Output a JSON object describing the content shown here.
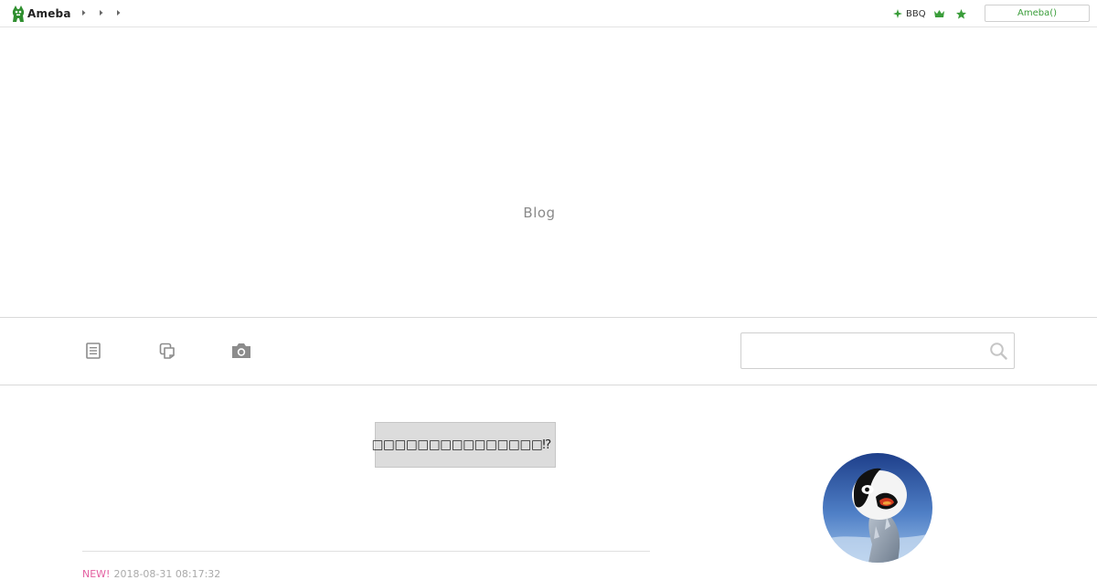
{
  "topbar": {
    "logo_text": "Ameba",
    "breadcrumb_count": 3,
    "bbq_label": "BBQ",
    "login_label": "Ameba()",
    "accent_color": "#3a9d3a"
  },
  "header": {
    "blog_title": "Blog"
  },
  "nav": {
    "icons": [
      "article-list-icon",
      "theme-icon",
      "photo-icon"
    ],
    "search_placeholder": "",
    "search_value": ""
  },
  "main": {
    "banner_text": "□□□□□□□□□□□□□□□⁉",
    "article": {
      "new_label": "NEW!",
      "date": "2018-08-31 08:17:32"
    }
  },
  "sidebar": {
    "avatar_subject": "penguin-chick"
  }
}
